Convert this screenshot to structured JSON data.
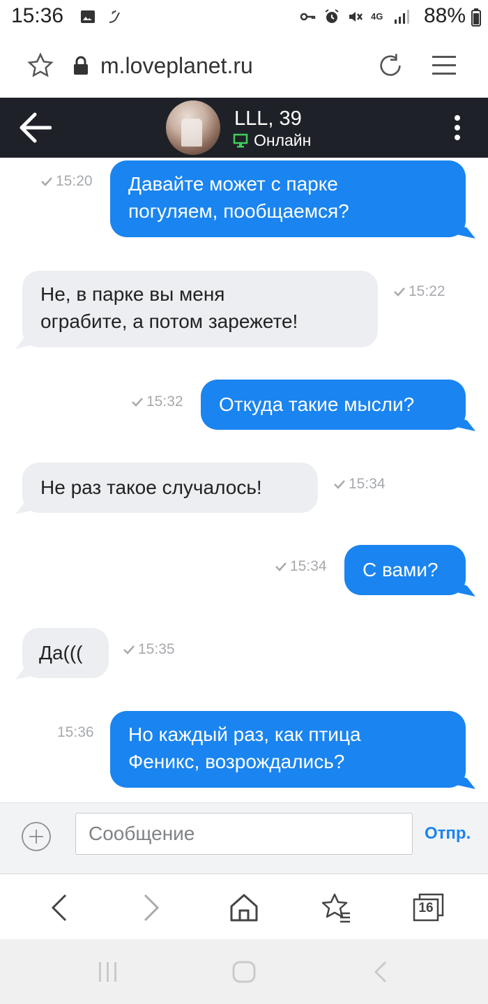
{
  "status_bar": {
    "time": "15:36",
    "network": "4G",
    "battery": "88%"
  },
  "browser": {
    "url": "m.loveplanet.ru"
  },
  "chat": {
    "contact_name": "LLL, 39",
    "contact_status": "Онлайн"
  },
  "messages": [
    {
      "direction": "out",
      "text": "Давайте может с парке\nпогуляем, пообщаемся?",
      "time": "15:20",
      "read": true
    },
    {
      "direction": "in",
      "text": "Не, в парке вы меня\nограбите, а потом зарежете!",
      "time": "15:22",
      "read": true
    },
    {
      "direction": "out",
      "text": "Откуда такие мысли?",
      "time": "15:32",
      "read": true
    },
    {
      "direction": "in",
      "text": "Не раз такое случалось!",
      "time": "15:34",
      "read": true
    },
    {
      "direction": "out",
      "text": "С вами?",
      "time": "15:34",
      "read": true
    },
    {
      "direction": "in",
      "text": "Да(((",
      "time": "15:35",
      "read": true
    },
    {
      "direction": "out",
      "text": "Но каждый раз, как птица\nФеникс, возрождались?",
      "time": "15:36",
      "read": false
    }
  ],
  "composer": {
    "placeholder": "Сообщение",
    "send_label": "Отпр."
  },
  "browser_toolbar": {
    "tabs_count": "16"
  },
  "colors": {
    "outgoing_bubble": "#1a84f0",
    "incoming_bubble": "#eceef1",
    "header_bg": "#1e2127",
    "online_green": "#3fcf5b"
  }
}
